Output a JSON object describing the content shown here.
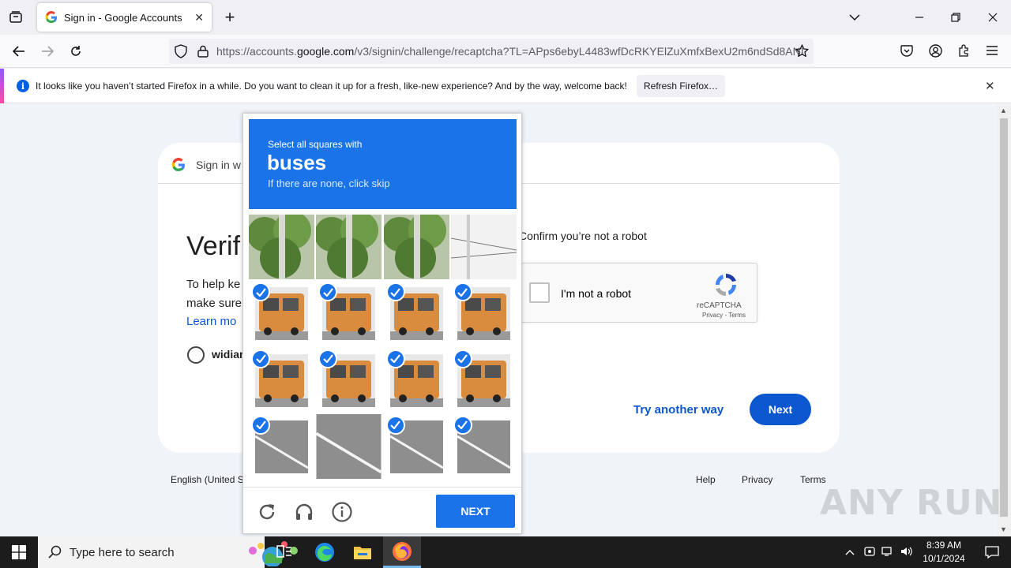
{
  "browser": {
    "tab_title": "Sign in - Google Accounts",
    "url_prefix": "https://accounts.",
    "url_domain": "google.com",
    "url_rest": "/v3/signin/challenge/recaptcha?TL=APps6ebyL4483wfDcRKYElZuXmfxBexU2m6ndSd8ANI",
    "notification": "It looks like you haven’t started Firefox in a while. Do you want to clean it up for a fresh, like-new experience? And by the way, welcome back!",
    "refresh_label": "Refresh Firefox…"
  },
  "page": {
    "header_text": "Sign in w",
    "heading": "Verif",
    "help_line1": "To help ke",
    "help_line2": "make sure",
    "learn_more": "Learn mo",
    "account": "widian",
    "confirm_text": "Confirm you’re not a robot",
    "checkbox_label": "I'm not a robot",
    "recaptcha_name": "reCAPTCHA",
    "recaptcha_links": "Privacy - Terms",
    "try_another": "Try another way",
    "next_label": "Next",
    "footer_lang": "English (United S",
    "footer_help": "Help",
    "footer_privacy": "Privacy",
    "footer_terms": "Terms"
  },
  "challenge": {
    "line1": "Select all squares with",
    "keyword": "buses",
    "line3": "If there are none, click skip",
    "next_label": "NEXT",
    "tiles": [
      {
        "row": 0,
        "col": 0,
        "selected": false,
        "kind": "tree"
      },
      {
        "row": 0,
        "col": 1,
        "selected": false,
        "kind": "tree"
      },
      {
        "row": 0,
        "col": 2,
        "selected": false,
        "kind": "tree"
      },
      {
        "row": 0,
        "col": 3,
        "selected": false,
        "kind": "sky"
      },
      {
        "row": 1,
        "col": 0,
        "selected": true,
        "kind": "bus"
      },
      {
        "row": 1,
        "col": 1,
        "selected": true,
        "kind": "bus"
      },
      {
        "row": 1,
        "col": 2,
        "selected": true,
        "kind": "bus"
      },
      {
        "row": 1,
        "col": 3,
        "selected": true,
        "kind": "bus"
      },
      {
        "row": 2,
        "col": 0,
        "selected": true,
        "kind": "bus"
      },
      {
        "row": 2,
        "col": 1,
        "selected": true,
        "kind": "bus"
      },
      {
        "row": 2,
        "col": 2,
        "selected": true,
        "kind": "bus"
      },
      {
        "row": 2,
        "col": 3,
        "selected": true,
        "kind": "bus"
      },
      {
        "row": 3,
        "col": 0,
        "selected": true,
        "kind": "road"
      },
      {
        "row": 3,
        "col": 1,
        "selected": false,
        "kind": "road"
      },
      {
        "row": 3,
        "col": 2,
        "selected": true,
        "kind": "road"
      },
      {
        "row": 3,
        "col": 3,
        "selected": true,
        "kind": "road"
      }
    ]
  },
  "watermark": "ANY RUN",
  "taskbar": {
    "search_placeholder": "Type here to search",
    "time": "8:39 AM",
    "date": "10/1/2024"
  },
  "colors": {
    "google_blue": "#0b57d0",
    "recaptcha_blue": "#1a73e8",
    "bus_orange": "#d98c3e"
  }
}
